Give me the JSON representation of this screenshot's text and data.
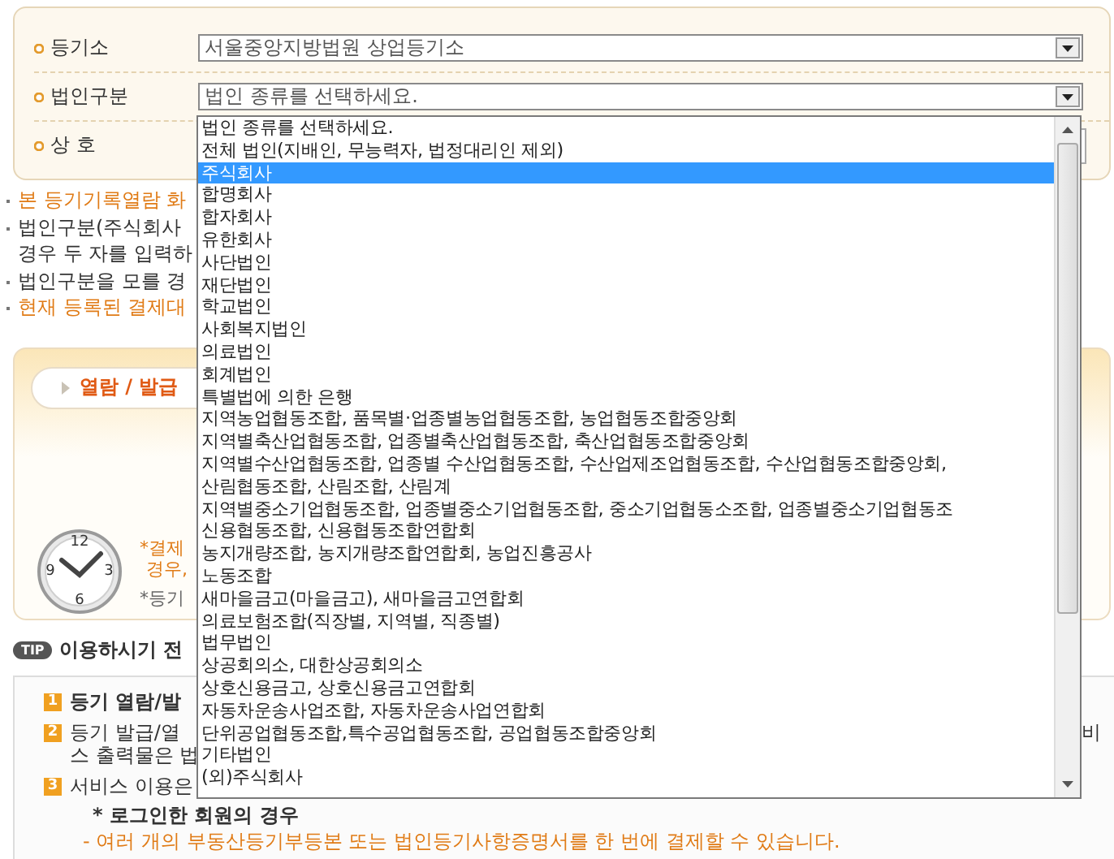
{
  "form": {
    "rows": [
      {
        "label": "등기소",
        "kind": "select",
        "value": "서울중앙지방법원 상업등기소"
      },
      {
        "label": "법인구분",
        "kind": "select",
        "value": "법인 종류를 선택하세요."
      },
      {
        "label": "상 호",
        "kind": "input"
      }
    ]
  },
  "dropdown": {
    "items": [
      {
        "label": "법인 종류를 선택하세요.",
        "selected": false
      },
      {
        "label": "전체 법인(지배인, 무능력자, 법정대리인 제외)",
        "selected": false
      },
      {
        "label": "주식회사",
        "selected": true
      },
      {
        "label": "합명회사",
        "selected": false
      },
      {
        "label": "합자회사",
        "selected": false
      },
      {
        "label": "유한회사",
        "selected": false
      },
      {
        "label": "사단법인",
        "selected": false
      },
      {
        "label": "재단법인",
        "selected": false
      },
      {
        "label": "학교법인",
        "selected": false
      },
      {
        "label": "사회복지법인",
        "selected": false
      },
      {
        "label": "의료법인",
        "selected": false
      },
      {
        "label": "회계법인",
        "selected": false
      },
      {
        "label": "특별법에 의한 은행",
        "selected": false
      },
      {
        "label": "지역농업협동조합, 품목별·업종별농업협동조합, 농업협동조합중앙회",
        "selected": false
      },
      {
        "label": "지역별축산업협동조합, 업종별축산업협동조합, 축산업협동조합중앙회",
        "selected": false
      },
      {
        "label": "지역별수산업협동조합, 업종별 수산업협동조합, 수산업제조업협동조합, 수산업협동조합중앙회,",
        "selected": false
      },
      {
        "label": "산림협동조합, 산림조합, 산림계",
        "selected": false
      },
      {
        "label": "지역별중소기업협동조합, 업종별중소기업협동조합, 중소기업협동소조합, 업종별중소기업협동조",
        "selected": false
      },
      {
        "label": "신용협동조합, 신용협동조합연합회",
        "selected": false
      },
      {
        "label": "농지개량조합, 농지개량조합연합회, 농업진흥공사",
        "selected": false
      },
      {
        "label": "노동조합",
        "selected": false
      },
      {
        "label": "새마을금고(마을금고), 새마을금고연합회",
        "selected": false
      },
      {
        "label": "의료보험조합(직장별, 지역별, 직종별)",
        "selected": false
      },
      {
        "label": "법무법인",
        "selected": false
      },
      {
        "label": "상공회의소, 대한상공회의소",
        "selected": false
      },
      {
        "label": "상호신용금고, 상호신용금고연합회",
        "selected": false
      },
      {
        "label": "자동차운송사업조합, 자동차운송사업연합회",
        "selected": false
      },
      {
        "label": "단위공업협동조합,특수공업협동조합, 공업협동조합중앙회",
        "selected": false
      },
      {
        "label": "기타법인",
        "selected": false
      },
      {
        "label": "(외)주식회사",
        "selected": false
      }
    ]
  },
  "notes": [
    {
      "kind": "highlight",
      "lines": [
        "본 등기기록열람 화"
      ]
    },
    {
      "kind": "plain",
      "lines": [
        "법인구분(주식회사",
        "경우 두 자를 입력하"
      ]
    },
    {
      "kind": "plain",
      "lines": [
        "법인구분을 모를 경"
      ]
    },
    {
      "kind": "highlight",
      "lines": [
        "현재 등록된 결제대"
      ]
    }
  ],
  "service": {
    "tab": {
      "highlight": "열람 / 발급"
    },
    "clock": {
      "numerals": [
        "12",
        "3",
        "6",
        "9"
      ]
    },
    "notices": [
      {
        "kind": "highlight",
        "text": "*결제"
      },
      {
        "kind": "highlight",
        "text": "경우,"
      },
      {
        "kind": "plain",
        "text": "*등기"
      }
    ]
  },
  "tip": {
    "badge": "TIP",
    "title": "이용하시기 전"
  },
  "guide": {
    "items": [
      {
        "number": "1",
        "kind": "heading",
        "lines": [
          "등기 열람/발"
        ]
      },
      {
        "number": "2",
        "kind": "plain",
        "lines": [
          "등기 발급/열",
          "스 출력물은 법"
        ],
        "tail": "비"
      },
      {
        "number": "3",
        "kind": "plain",
        "lines": [
          "서비스 이용은"
        ]
      }
    ],
    "sub_heading": "* 로그인한 회원의 경우",
    "sub_note": "- 여러 개의 부동산등기부등본 또는 법인등기사항증명서를 한 번에 결제할 수 있습니다."
  }
}
